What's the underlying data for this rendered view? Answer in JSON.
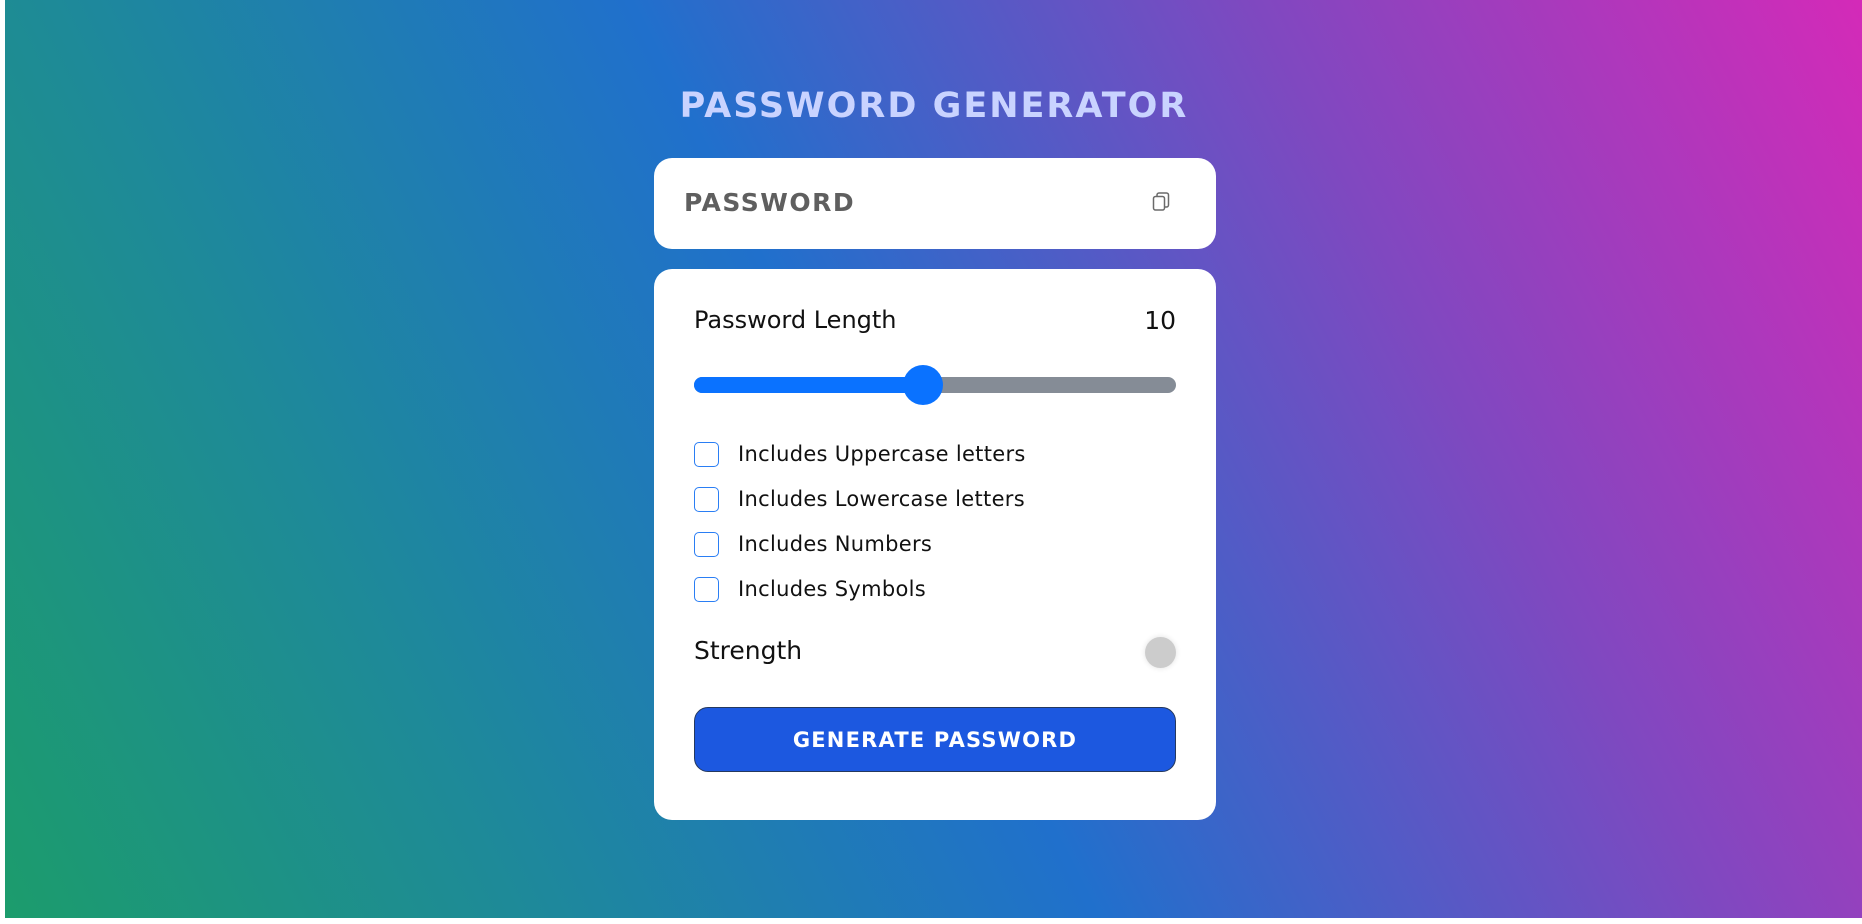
{
  "title": "PASSWORD GENERATOR",
  "password_display": {
    "text": "PASSWORD",
    "copy_icon": "copy-icon"
  },
  "length": {
    "label": "Password Length",
    "value": "10",
    "slider_fraction": 0.475
  },
  "options": [
    {
      "label": "Includes Uppercase letters",
      "checked": false
    },
    {
      "label": "Includes Lowercase letters",
      "checked": false
    },
    {
      "label": "Includes Numbers",
      "checked": false
    },
    {
      "label": "Includes Symbols",
      "checked": false
    }
  ],
  "strength": {
    "label": "Strength",
    "indicator_color": "#cccccc"
  },
  "generate_button": {
    "label": "GENERATE PASSWORD"
  },
  "colors": {
    "accent": "#0a72ff",
    "button": "#1c58e0",
    "title": "#c9d3ff",
    "checkbox_border": "#2a7ef4"
  }
}
